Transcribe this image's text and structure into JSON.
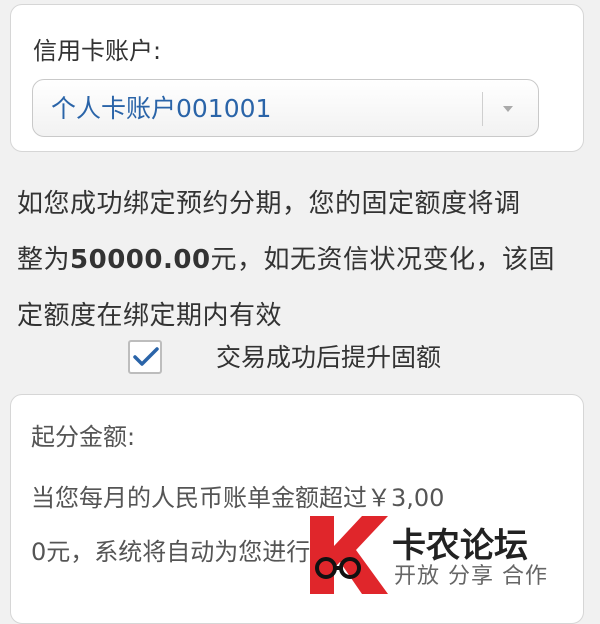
{
  "account_card": {
    "label": "信用卡账户:",
    "selected_account": "个人卡账户001001"
  },
  "info": {
    "line1": "如您成功绑定预约分期，您的固定额度将调",
    "line2_prefix": "整为",
    "line2_amount": "50000.00",
    "line2_suffix": "元，如无资信状况变化，该固",
    "line3": "定额度在绑定期内有效"
  },
  "checkbox": {
    "label": "交易成功后提升固额",
    "checked": true
  },
  "threshold_card": {
    "title": "起分金额:",
    "line1": "当您每月的人民币账单金额超过￥3,00",
    "line2": "0元，系统将自动为您进行账"
  },
  "watermark": {
    "brand": "卡农论坛",
    "slogan": "开放 分享 合作"
  },
  "colors": {
    "accent_blue": "#2a64a8",
    "logo_red": "#e0262b"
  }
}
